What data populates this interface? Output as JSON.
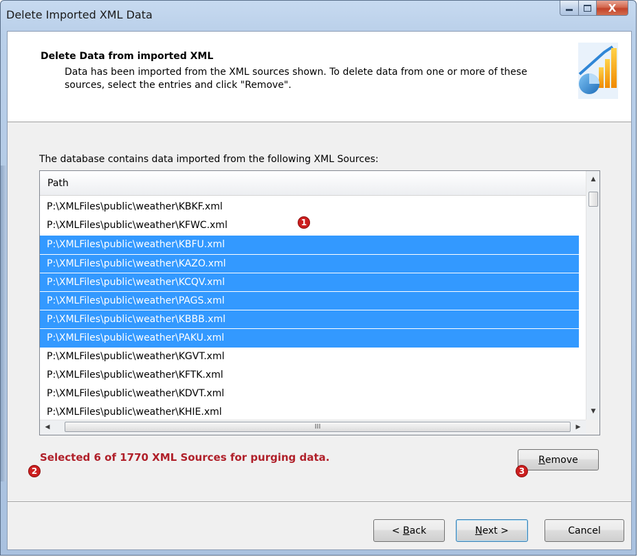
{
  "window": {
    "title": "Delete Imported XML Data",
    "close_glyph": "X"
  },
  "header": {
    "title": "Delete Data from imported XML",
    "description": "Data has been imported from the XML sources shown. To delete data from one or more of these sources, select the entries and click \"Remove\".",
    "logo_icon": "chart-graphic-icon"
  },
  "list": {
    "label": "The database contains data imported from the following XML Sources:",
    "column_header": "Path",
    "rows": [
      {
        "path": "P:\\XMLFiles\\public\\weather\\KBKF.xml",
        "selected": false
      },
      {
        "path": "P:\\XMLFiles\\public\\weather\\KFWC.xml",
        "selected": false
      },
      {
        "path": "P:\\XMLFiles\\public\\weather\\KBFU.xml",
        "selected": true
      },
      {
        "path": "P:\\XMLFiles\\public\\weather\\KAZO.xml",
        "selected": true
      },
      {
        "path": "P:\\XMLFiles\\public\\weather\\KCQV.xml",
        "selected": true
      },
      {
        "path": "P:\\XMLFiles\\public\\weather\\PAGS.xml",
        "selected": true
      },
      {
        "path": "P:\\XMLFiles\\public\\weather\\KBBB.xml",
        "selected": true
      },
      {
        "path": "P:\\XMLFiles\\public\\weather\\PAKU.xml",
        "selected": true
      },
      {
        "path": "P:\\XMLFiles\\public\\weather\\KGVT.xml",
        "selected": false
      },
      {
        "path": "P:\\XMLFiles\\public\\weather\\KFTK.xml",
        "selected": false
      },
      {
        "path": "P:\\XMLFiles\\public\\weather\\KDVT.xml",
        "selected": false
      },
      {
        "path": "P:\\XMLFiles\\public\\weather\\KHIE.xml",
        "selected": false
      }
    ],
    "hscroll_grip": "III"
  },
  "status": {
    "text": "Selected 6 of 1770 XML Sources for purging data."
  },
  "buttons": {
    "remove_hotkey": "R",
    "remove_rest": "emove",
    "back_prefix": "< ",
    "back_hotkey": "B",
    "back_rest": "ack",
    "next_hotkey": "N",
    "next_rest": "ext >",
    "cancel": "Cancel"
  },
  "callouts": [
    "1",
    "2",
    "3"
  ],
  "colors": {
    "selection": "#3399ff",
    "status_text": "#b0202a",
    "callout": "#cc1f1f"
  }
}
